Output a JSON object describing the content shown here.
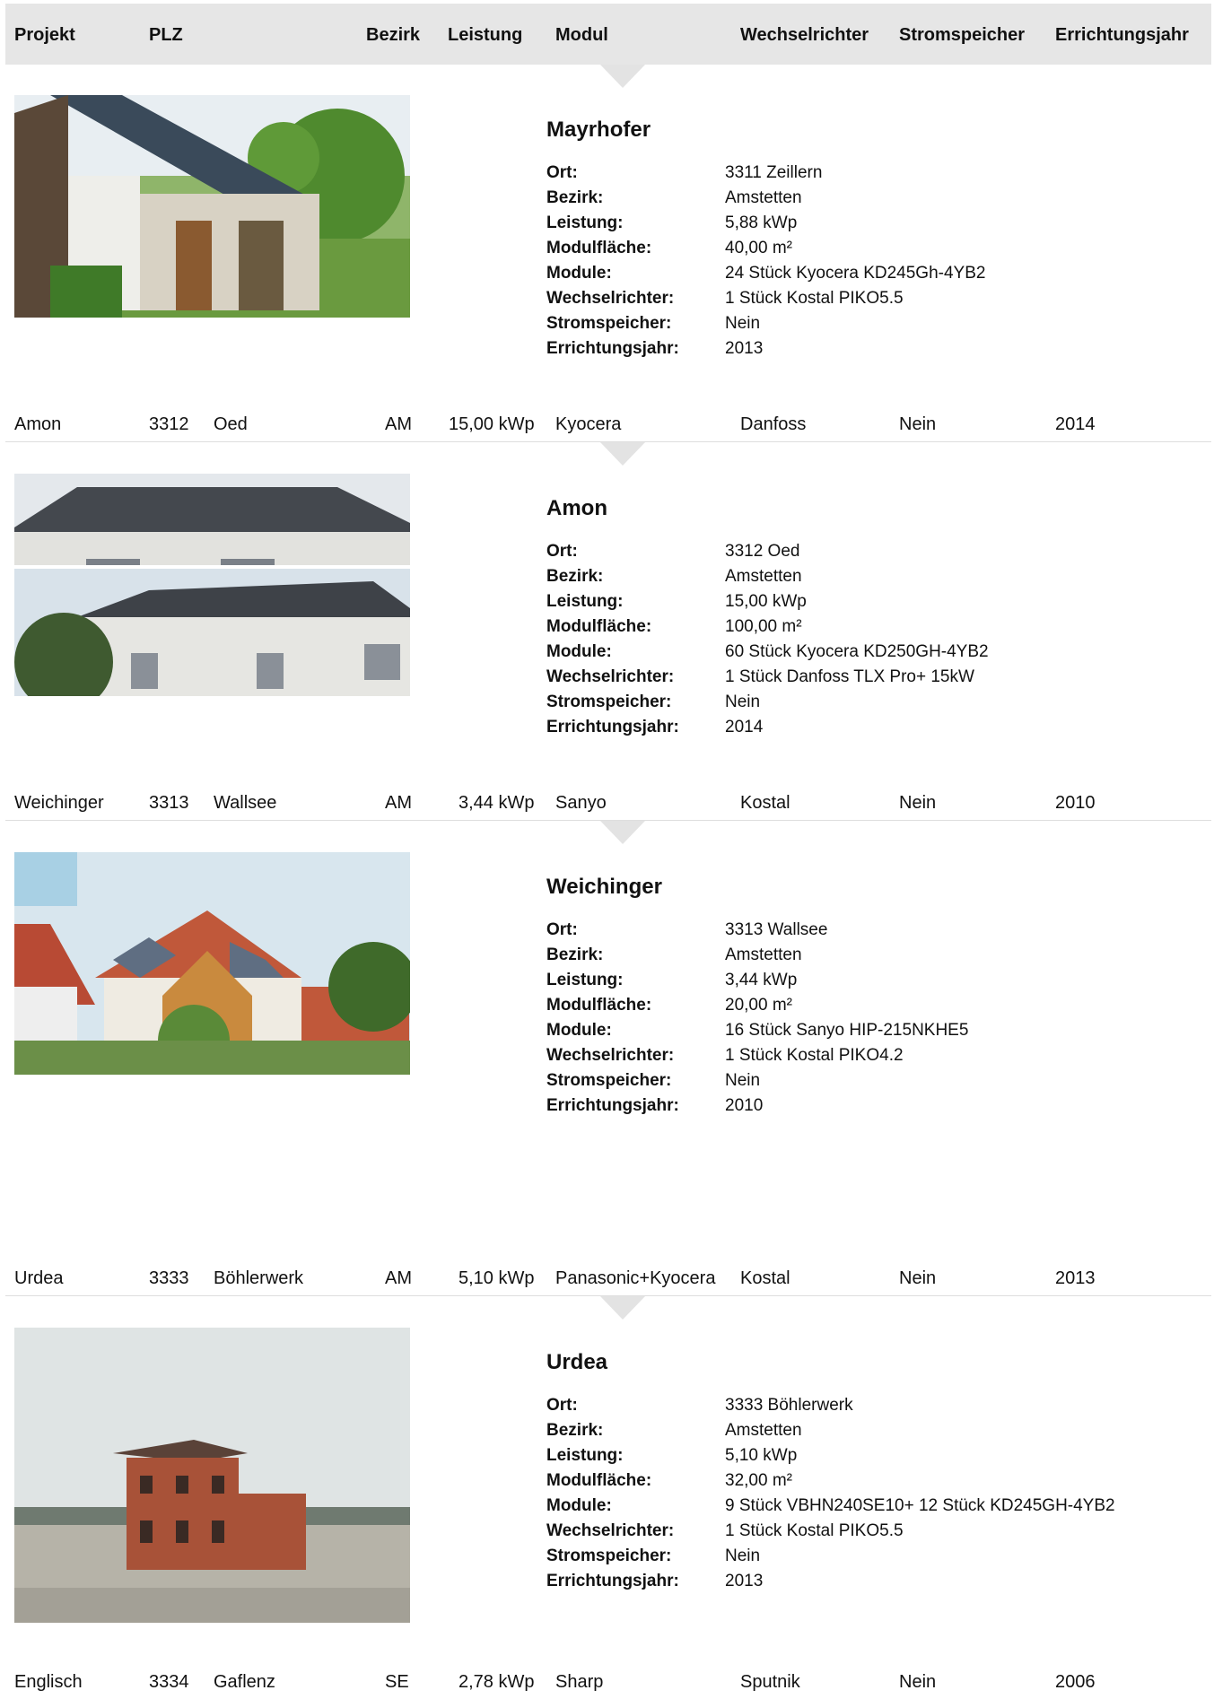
{
  "header": {
    "projekt": "Projekt",
    "plz": "PLZ",
    "bezirk": "Bezirk",
    "leistung": "Leistung",
    "modul": "Modul",
    "wechselrichter": "Wechselrichter",
    "stromspeicher": "Stromspeicher",
    "errichtungsjahr": "Errichtungsjahr"
  },
  "labels": {
    "ort": "Ort:",
    "bezirk": "Bezirk:",
    "leistung": "Leistung:",
    "modulflaeche": "Modulfläche:",
    "module": "Module:",
    "wechselrichter": "Wechselrichter:",
    "stromspeicher": "Stromspeicher:",
    "errichtungsjahr": "Errichtungsjahr:"
  },
  "details": [
    {
      "name": "Mayrhofer",
      "ort": "3311 Zeillern",
      "bezirk": "Amstetten",
      "leistung": "5,88 kWp",
      "modulflaeche": "40,00 m²",
      "module": "24 Stück Kyocera KD245Gh-4YB2",
      "wechselrichter": "1 Stück Kostal PIKO5.5",
      "stromspeicher": "Nein",
      "errichtungsjahr": "2013"
    },
    {
      "name": "Amon",
      "ort": "3312 Oed",
      "bezirk": "Amstetten",
      "leistung": "15,00 kWp",
      "modulflaeche": "100,00 m²",
      "module": "60 Stück Kyocera KD250GH-4YB2",
      "wechselrichter": "1 Stück Danfoss TLX Pro+ 15kW",
      "stromspeicher": "Nein",
      "errichtungsjahr": "2014"
    },
    {
      "name": "Weichinger",
      "ort": "3313 Wallsee",
      "bezirk": "Amstetten",
      "leistung": "3,44 kWp",
      "modulflaeche": "20,00 m²",
      "module": "16 Stück Sanyo HIP-215NKHE5",
      "wechselrichter": "1 Stück Kostal PIKO4.2",
      "stromspeicher": "Nein",
      "errichtungsjahr": "2010"
    },
    {
      "name": "Urdea",
      "ort": "3333 Böhlerwerk",
      "bezirk": "Amstetten",
      "leistung": "5,10 kWp",
      "modulflaeche": "32,00 m²",
      "module": "9 Stück VBHN240SE10+ 12 Stück KD245GH-4YB2",
      "wechselrichter": "1 Stück Kostal PIKO5.5",
      "stromspeicher": "Nein",
      "errichtungsjahr": "2013"
    }
  ],
  "rows": [
    {
      "projekt": "Amon",
      "plz": "3312",
      "ort": "Oed",
      "bezirk": "AM",
      "leistung": "15,00 kWp",
      "modul": "Kyocera",
      "wechselrichter": "Danfoss",
      "stromspeicher": "Nein",
      "errichtungsjahr": "2014"
    },
    {
      "projekt": "Weichinger",
      "plz": "3313",
      "ort": "Wallsee",
      "bezirk": "AM",
      "leistung": "3,44 kWp",
      "modul": "Sanyo",
      "wechselrichter": "Kostal",
      "stromspeicher": "Nein",
      "errichtungsjahr": "2010"
    },
    {
      "projekt": "Urdea",
      "plz": "3333",
      "ort": "Böhlerwerk",
      "bezirk": "AM",
      "leistung": "5,10 kWp",
      "modul": "Panasonic+Kyocera",
      "wechselrichter": "Kostal",
      "stromspeicher": "Nein",
      "errichtungsjahr": "2013"
    },
    {
      "projekt": "Englisch",
      "plz": "3334",
      "ort": "Gaflenz",
      "bezirk": "SE",
      "leistung": "2,78 kWp",
      "modul": "Sharp",
      "wechselrichter": "Sputnik",
      "stromspeicher": "Nein",
      "errichtungsjahr": "2006"
    }
  ],
  "colors": {
    "header_bg": "#e6e6e6",
    "row_border": "#dedede",
    "arrow": "#e3e3e3",
    "text": "#111111"
  }
}
